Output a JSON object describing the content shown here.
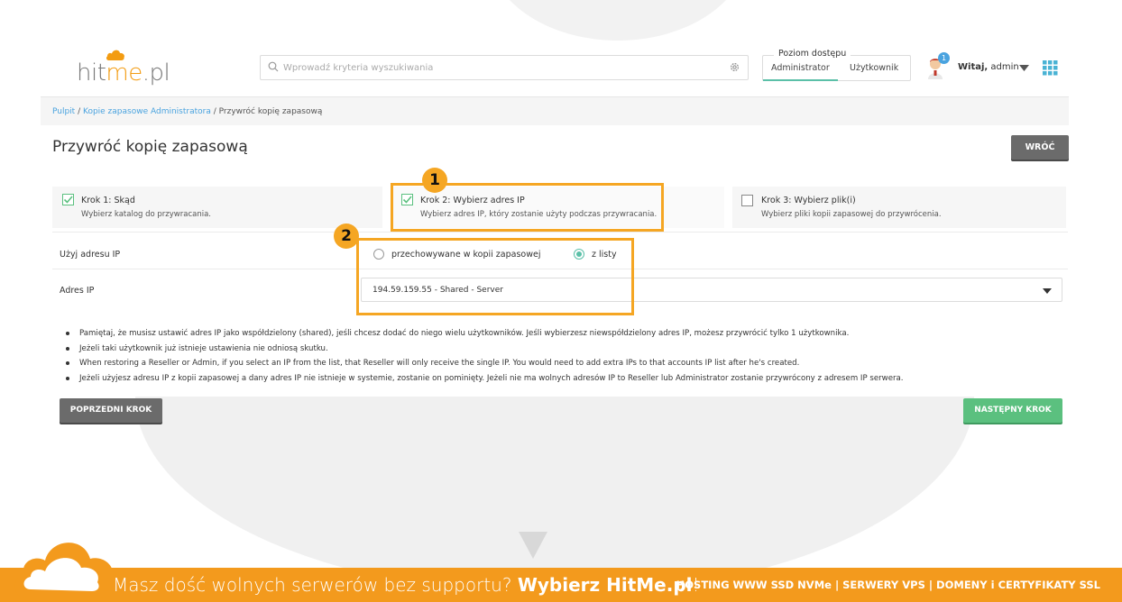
{
  "header": {
    "logo": {
      "part1": "hit",
      "part2": "me",
      "part3": ".pl"
    },
    "search_placeholder": "Wprowadź kryteria wyszukiwania",
    "access": {
      "title": "Poziom dostępu",
      "admin": "Administrator",
      "user": "Użytkownik",
      "selected": "Administrator"
    },
    "notifications": "1",
    "greeting_bold": "Witaj,",
    "greeting_user": "admin"
  },
  "breadcrumb": {
    "items": [
      "Pulpit",
      "Kopie zapasowe Administratora"
    ],
    "separator": " / ",
    "current": "Przywróć kopię zapasową"
  },
  "page": {
    "title": "Przywróć kopię zapasową",
    "back_button": "WRÓĆ"
  },
  "steps": [
    {
      "title": "Krok 1: Skąd",
      "desc": "Wybierz katalog do przywracania.",
      "checked": true
    },
    {
      "title": "Krok 2: Wybierz adres IP",
      "desc": "Wybierz adres IP, który zostanie użyty podczas przywracania.",
      "checked": true
    },
    {
      "title": "Krok 3: Wybierz plik(i)",
      "desc": "Wybierz pliki kopii zapasowej do przywrócenia.",
      "checked": false
    }
  ],
  "annotations": {
    "one": "1",
    "two": "2",
    "color": "#f5a623"
  },
  "form": {
    "use_ip_label": "Użyj adresu IP",
    "option_backup": "przechowywane w kopii zapasowej",
    "option_list": "z listy",
    "selected_option": "z listy",
    "ip_label": "Adres IP",
    "ip_value": "194.59.159.55 - Shared - Server"
  },
  "notes": [
    "Pamiętaj, że musisz ustawić adres IP jako współdzielony (shared), jeśli chcesz dodać do niego wielu użytkowników. Jeśli wybierzesz niewspółdzielony adres IP, możesz przywrócić tylko 1 użytkownika.",
    "Jeżeli taki użytkownik już istnieje ustawienia nie odniosą skutku.",
    "When restoring a Reseller or Admin, if you select an IP from the list, that Reseller will only receive the single IP. You would need to add extra IPs to that accounts IP list after he's created.",
    "Jeżeli użyjesz adresu IP z kopii zapasowej a dany adres IP nie istnieje w systemie, zostanie on pominięty. Jeżeli nie ma wolnych adresów IP to Reseller lub Administrator zostanie przywrócony z adresem IP serwera."
  ],
  "buttons": {
    "prev": "POPRZEDNI KROK",
    "next": "NASTĘPNY KROK"
  },
  "banner": {
    "text": "Masz dość wolnych serwerów bez supportu?",
    "brand": "Wybierz HitMe.pl",
    "exclaim": "!",
    "right": "HOSTING WWW SSD NVMe | SERWERY VPS | DOMENY i CERTYFIKATY SSL"
  },
  "colors": {
    "accent_orange": "#f39a1d",
    "green": "#5bc07f",
    "teal": "#5bc0a8",
    "link": "#4aa3df",
    "dark_button": "#6b6b6b"
  },
  "icons": [
    "search-icon",
    "gear-icon",
    "avatar-icon",
    "caret-down-icon",
    "apps-grid-icon",
    "check-icon",
    "cloud-icon"
  ]
}
